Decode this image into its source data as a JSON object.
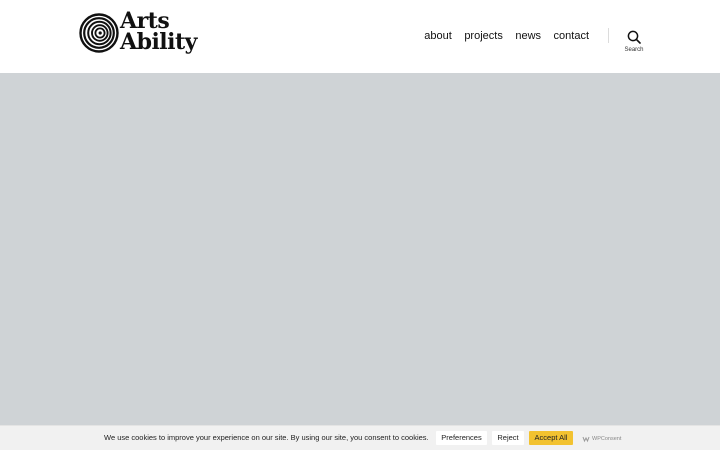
{
  "header": {
    "logo": {
      "line1": "Arts",
      "line2": "Ability"
    },
    "nav": [
      {
        "label": "about"
      },
      {
        "label": "projects"
      },
      {
        "label": "news"
      },
      {
        "label": "contact"
      }
    ],
    "search": {
      "label": "Search"
    }
  },
  "cover": {
    "background_color": "#cfd3d6"
  },
  "cookie_banner": {
    "message": "We use cookies to improve your experience on our site. By using our site, you consent to cookies.",
    "preferences_label": "Preferences",
    "reject_label": "Reject",
    "accept_label": "Accept All",
    "brand": "WPConsent",
    "accept_color": "#f2c230"
  },
  "icons": {
    "logo": "spiral-logo-icon",
    "search": "search-icon",
    "brand": "wpconsent-icon"
  }
}
